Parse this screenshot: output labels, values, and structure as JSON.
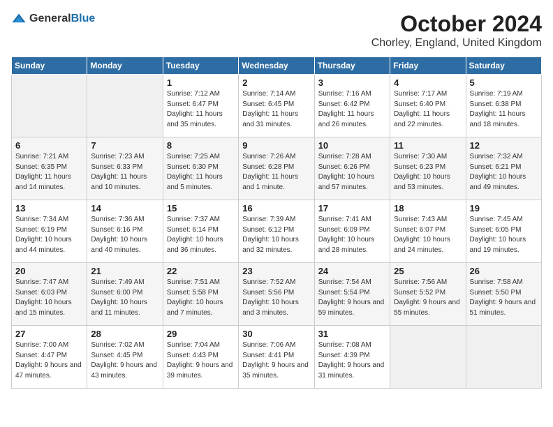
{
  "logo": {
    "general": "General",
    "blue": "Blue"
  },
  "header": {
    "month": "October 2024",
    "location": "Chorley, England, United Kingdom"
  },
  "weekdays": [
    "Sunday",
    "Monday",
    "Tuesday",
    "Wednesday",
    "Thursday",
    "Friday",
    "Saturday"
  ],
  "weeks": [
    [
      {
        "day": "",
        "sunrise": "",
        "sunset": "",
        "daylight": ""
      },
      {
        "day": "",
        "sunrise": "",
        "sunset": "",
        "daylight": ""
      },
      {
        "day": "1",
        "sunrise": "Sunrise: 7:12 AM",
        "sunset": "Sunset: 6:47 PM",
        "daylight": "Daylight: 11 hours and 35 minutes."
      },
      {
        "day": "2",
        "sunrise": "Sunrise: 7:14 AM",
        "sunset": "Sunset: 6:45 PM",
        "daylight": "Daylight: 11 hours and 31 minutes."
      },
      {
        "day": "3",
        "sunrise": "Sunrise: 7:16 AM",
        "sunset": "Sunset: 6:42 PM",
        "daylight": "Daylight: 11 hours and 26 minutes."
      },
      {
        "day": "4",
        "sunrise": "Sunrise: 7:17 AM",
        "sunset": "Sunset: 6:40 PM",
        "daylight": "Daylight: 11 hours and 22 minutes."
      },
      {
        "day": "5",
        "sunrise": "Sunrise: 7:19 AM",
        "sunset": "Sunset: 6:38 PM",
        "daylight": "Daylight: 11 hours and 18 minutes."
      }
    ],
    [
      {
        "day": "6",
        "sunrise": "Sunrise: 7:21 AM",
        "sunset": "Sunset: 6:35 PM",
        "daylight": "Daylight: 11 hours and 14 minutes."
      },
      {
        "day": "7",
        "sunrise": "Sunrise: 7:23 AM",
        "sunset": "Sunset: 6:33 PM",
        "daylight": "Daylight: 11 hours and 10 minutes."
      },
      {
        "day": "8",
        "sunrise": "Sunrise: 7:25 AM",
        "sunset": "Sunset: 6:30 PM",
        "daylight": "Daylight: 11 hours and 5 minutes."
      },
      {
        "day": "9",
        "sunrise": "Sunrise: 7:26 AM",
        "sunset": "Sunset: 6:28 PM",
        "daylight": "Daylight: 11 hours and 1 minute."
      },
      {
        "day": "10",
        "sunrise": "Sunrise: 7:28 AM",
        "sunset": "Sunset: 6:26 PM",
        "daylight": "Daylight: 10 hours and 57 minutes."
      },
      {
        "day": "11",
        "sunrise": "Sunrise: 7:30 AM",
        "sunset": "Sunset: 6:23 PM",
        "daylight": "Daylight: 10 hours and 53 minutes."
      },
      {
        "day": "12",
        "sunrise": "Sunrise: 7:32 AM",
        "sunset": "Sunset: 6:21 PM",
        "daylight": "Daylight: 10 hours and 49 minutes."
      }
    ],
    [
      {
        "day": "13",
        "sunrise": "Sunrise: 7:34 AM",
        "sunset": "Sunset: 6:19 PM",
        "daylight": "Daylight: 10 hours and 44 minutes."
      },
      {
        "day": "14",
        "sunrise": "Sunrise: 7:36 AM",
        "sunset": "Sunset: 6:16 PM",
        "daylight": "Daylight: 10 hours and 40 minutes."
      },
      {
        "day": "15",
        "sunrise": "Sunrise: 7:37 AM",
        "sunset": "Sunset: 6:14 PM",
        "daylight": "Daylight: 10 hours and 36 minutes."
      },
      {
        "day": "16",
        "sunrise": "Sunrise: 7:39 AM",
        "sunset": "Sunset: 6:12 PM",
        "daylight": "Daylight: 10 hours and 32 minutes."
      },
      {
        "day": "17",
        "sunrise": "Sunrise: 7:41 AM",
        "sunset": "Sunset: 6:09 PM",
        "daylight": "Daylight: 10 hours and 28 minutes."
      },
      {
        "day": "18",
        "sunrise": "Sunrise: 7:43 AM",
        "sunset": "Sunset: 6:07 PM",
        "daylight": "Daylight: 10 hours and 24 minutes."
      },
      {
        "day": "19",
        "sunrise": "Sunrise: 7:45 AM",
        "sunset": "Sunset: 6:05 PM",
        "daylight": "Daylight: 10 hours and 19 minutes."
      }
    ],
    [
      {
        "day": "20",
        "sunrise": "Sunrise: 7:47 AM",
        "sunset": "Sunset: 6:03 PM",
        "daylight": "Daylight: 10 hours and 15 minutes."
      },
      {
        "day": "21",
        "sunrise": "Sunrise: 7:49 AM",
        "sunset": "Sunset: 6:00 PM",
        "daylight": "Daylight: 10 hours and 11 minutes."
      },
      {
        "day": "22",
        "sunrise": "Sunrise: 7:51 AM",
        "sunset": "Sunset: 5:58 PM",
        "daylight": "Daylight: 10 hours and 7 minutes."
      },
      {
        "day": "23",
        "sunrise": "Sunrise: 7:52 AM",
        "sunset": "Sunset: 5:56 PM",
        "daylight": "Daylight: 10 hours and 3 minutes."
      },
      {
        "day": "24",
        "sunrise": "Sunrise: 7:54 AM",
        "sunset": "Sunset: 5:54 PM",
        "daylight": "Daylight: 9 hours and 59 minutes."
      },
      {
        "day": "25",
        "sunrise": "Sunrise: 7:56 AM",
        "sunset": "Sunset: 5:52 PM",
        "daylight": "Daylight: 9 hours and 55 minutes."
      },
      {
        "day": "26",
        "sunrise": "Sunrise: 7:58 AM",
        "sunset": "Sunset: 5:50 PM",
        "daylight": "Daylight: 9 hours and 51 minutes."
      }
    ],
    [
      {
        "day": "27",
        "sunrise": "Sunrise: 7:00 AM",
        "sunset": "Sunset: 4:47 PM",
        "daylight": "Daylight: 9 hours and 47 minutes."
      },
      {
        "day": "28",
        "sunrise": "Sunrise: 7:02 AM",
        "sunset": "Sunset: 4:45 PM",
        "daylight": "Daylight: 9 hours and 43 minutes."
      },
      {
        "day": "29",
        "sunrise": "Sunrise: 7:04 AM",
        "sunset": "Sunset: 4:43 PM",
        "daylight": "Daylight: 9 hours and 39 minutes."
      },
      {
        "day": "30",
        "sunrise": "Sunrise: 7:06 AM",
        "sunset": "Sunset: 4:41 PM",
        "daylight": "Daylight: 9 hours and 35 minutes."
      },
      {
        "day": "31",
        "sunrise": "Sunrise: 7:08 AM",
        "sunset": "Sunset: 4:39 PM",
        "daylight": "Daylight: 9 hours and 31 minutes."
      },
      {
        "day": "",
        "sunrise": "",
        "sunset": "",
        "daylight": ""
      },
      {
        "day": "",
        "sunrise": "",
        "sunset": "",
        "daylight": ""
      }
    ]
  ]
}
